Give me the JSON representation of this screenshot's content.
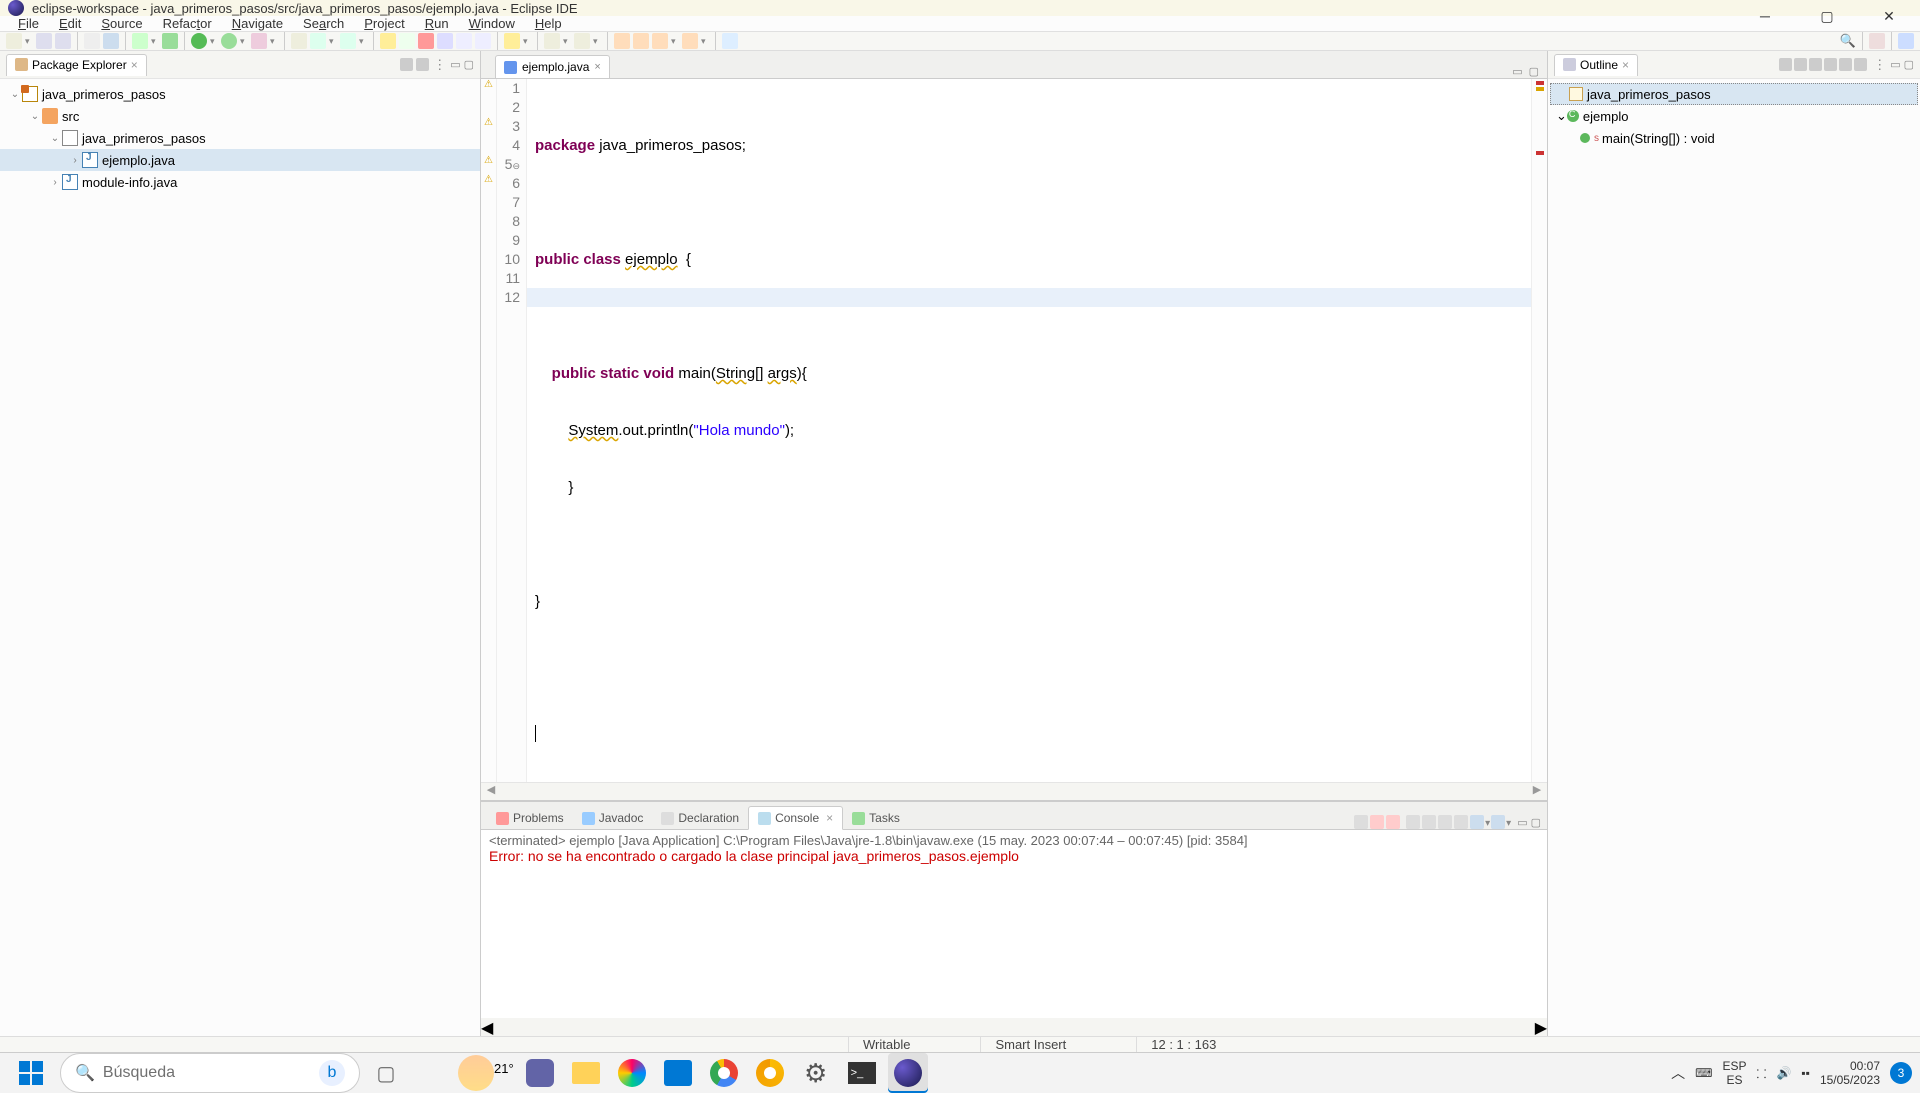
{
  "titlebar": {
    "title": "eclipse-workspace - java_primeros_pasos/src/java_primeros_pasos/ejemplo.java - Eclipse IDE"
  },
  "menubar": {
    "items": [
      "File",
      "Edit",
      "Source",
      "Refactor",
      "Navigate",
      "Search",
      "Project",
      "Run",
      "Window",
      "Help"
    ]
  },
  "package_explorer": {
    "title": "Package Explorer",
    "project": "java_primeros_pasos",
    "src": "src",
    "pkg": "java_primeros_pasos",
    "file1": "ejemplo.java",
    "file2": "module-info.java"
  },
  "editor": {
    "tab": "ejemplo.java",
    "lines": {
      "l1a": "package",
      "l1b": " java_primeros_pasos;",
      "l3a": "public class ",
      "l3b": "ejemplo",
      "l3c": "  {",
      "l5a": "    ",
      "l5b": "public static void",
      "l5c": " main(",
      "l5d": "String",
      "l5e": "[] ",
      "l5f": "args",
      "l5g": "){",
      "l6a": "        ",
      "l6b": "System",
      "l6c": ".out.println(",
      "l6d": "\"Hola mundo\"",
      "l6e": ");",
      "l7": "        }",
      "l9": "}"
    },
    "gutter": [
      "1",
      "2",
      "3",
      "4",
      "5",
      "6",
      "7",
      "8",
      "9",
      "10",
      "11",
      "12"
    ]
  },
  "bottom": {
    "tabs": {
      "problems": "Problems",
      "javadoc": "Javadoc",
      "declaration": "Declaration",
      "console": "Console",
      "tasks": "Tasks"
    },
    "console_hdr": "<terminated> ejemplo [Java Application] C:\\Program Files\\Java\\jre-1.8\\bin\\javaw.exe  (15 may. 2023 00:07:44 – 00:07:45) [pid: 3584]",
    "console_err": "Error: no se ha encontrado o cargado la clase principal java_primeros_pasos.ejemplo"
  },
  "outline": {
    "title": "Outline",
    "pkg": "java_primeros_pasos",
    "cls": "ejemplo",
    "mth": "main(String[]) : void"
  },
  "statusbar": {
    "writable": "Writable",
    "insert": "Smart Insert",
    "pos": "12 : 1 : 163"
  },
  "taskbar": {
    "search_placeholder": "Búsqueda",
    "weather": "21°",
    "lang_top": "ESP",
    "lang_bot": "ES",
    "time": "00:07",
    "date": "15/05/2023",
    "notif": "3"
  }
}
